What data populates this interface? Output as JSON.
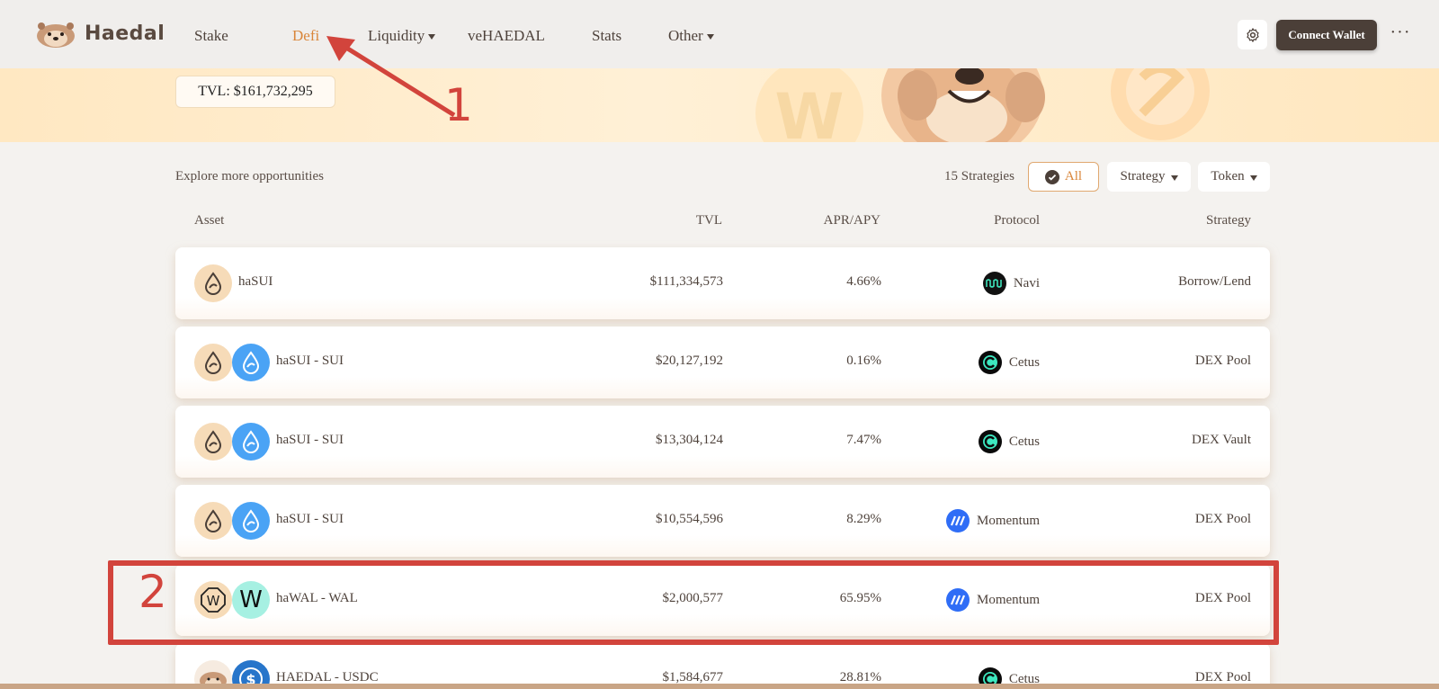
{
  "brand": {
    "name": "Haedal"
  },
  "nav": {
    "items": [
      {
        "label": "Stake",
        "dropdown": false
      },
      {
        "label": "Defi",
        "dropdown": false,
        "active": true
      },
      {
        "label": "Liquidity",
        "dropdown": true
      },
      {
        "label": "veHAEDAL",
        "dropdown": false
      },
      {
        "label": "Stats",
        "dropdown": false
      },
      {
        "label": "Other",
        "dropdown": true
      }
    ]
  },
  "header": {
    "connect_label": "Connect Wallet",
    "more_label": "···"
  },
  "banner": {
    "tvl": "TVL: $161,732,295"
  },
  "filters": {
    "explore_text": "Explore more opportunities",
    "strategy_count": "15 Strategies",
    "all_label": "All",
    "strategy_label": "Strategy",
    "token_label": "Token"
  },
  "table": {
    "headers": {
      "asset": "Asset",
      "tvl": "TVL",
      "apr": "APR/APY",
      "protocol": "Protocol",
      "strategy": "Strategy"
    },
    "rows": [
      {
        "asset": "haSUI",
        "tvl": "$111,334,573",
        "apr": "4.66%",
        "protocol": "Navi",
        "strategy": "Borrow/Lend"
      },
      {
        "asset": "haSUI - SUI",
        "tvl": "$20,127,192",
        "apr": "0.16%",
        "protocol": "Cetus",
        "strategy": "DEX Pool"
      },
      {
        "asset": "haSUI - SUI",
        "tvl": "$13,304,124",
        "apr": "7.47%",
        "protocol": "Cetus",
        "strategy": "DEX Vault"
      },
      {
        "asset": "haSUI - SUI",
        "tvl": "$10,554,596",
        "apr": "8.29%",
        "protocol": "Momentum",
        "strategy": "DEX Pool"
      },
      {
        "asset": "haWAL - WAL",
        "tvl": "$2,000,577",
        "apr": "65.95%",
        "protocol": "Momentum",
        "strategy": "DEX Pool"
      },
      {
        "asset": "HAEDAL - USDC",
        "tvl": "$1,584,677",
        "apr": "28.81%",
        "protocol": "Cetus",
        "strategy": "DEX Pool"
      }
    ]
  },
  "annotations": {
    "one": "1",
    "two": "2"
  },
  "colors": {
    "accent": "#d9863a",
    "annotation": "#d2443c",
    "dark": "#4b3f38"
  },
  "icons": [
    "otter-logo-icon",
    "gear-icon",
    "check-icon",
    "sui-drop-icon",
    "wal-icon",
    "navi-icon",
    "cetus-icon",
    "momentum-icon",
    "usdc-icon"
  ]
}
